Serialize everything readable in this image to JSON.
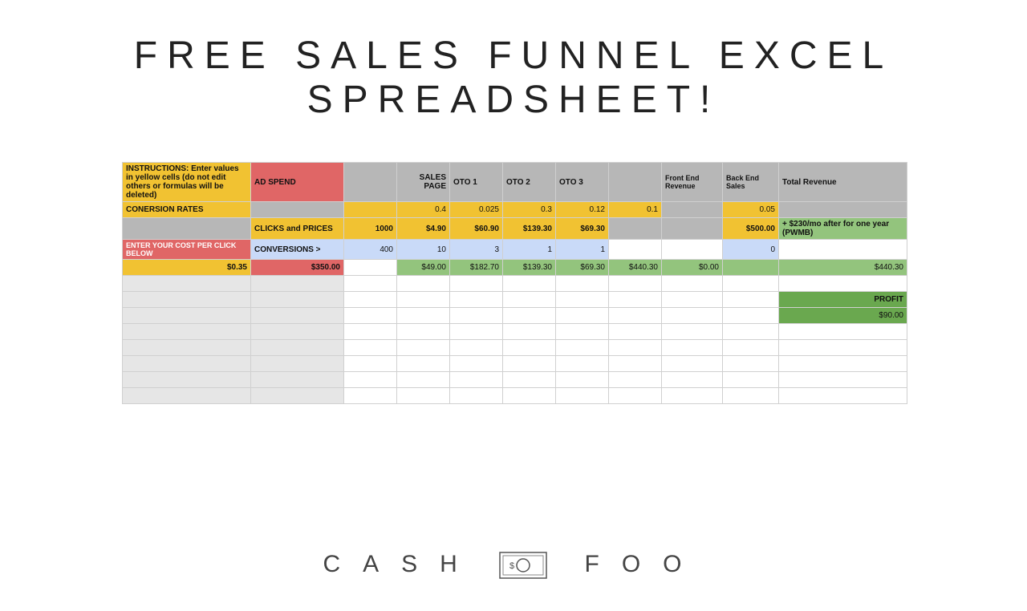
{
  "title": "FREE SALES FUNNEL EXCEL SPREADSHEET!",
  "brand": {
    "left": "CASH",
    "right": "FOO"
  },
  "sheet": {
    "header": {
      "instructions": "INSTRUCTIONS: Enter values in yellow cells (do not edit others or formulas will be deleted)",
      "ad_spend": "AD SPEND",
      "sales_page": "SALES PAGE",
      "oto1": "OTO 1",
      "oto2": "OTO 2",
      "oto3": "OTO 3",
      "front_rev": "Front End Revenue",
      "back_sales": "Back End Sales",
      "total_rev": "Total Revenue"
    },
    "rates": {
      "label": "CONERSION RATES",
      "sales_page": "0.4",
      "oto1": "0.025",
      "oto2": "0.3",
      "oto3": "0.12",
      "front_rev": "0.1",
      "back_sales": "0.05"
    },
    "clicks": {
      "label": "CLICKS and PRICES",
      "val1": "1000",
      "sales_page": "$4.90",
      "oto1": "$60.90",
      "oto2": "$139.30",
      "oto3": "$69.30",
      "back": "$500.00",
      "note": "+ $230/mo after for one year (PWMB)"
    },
    "conv": {
      "left_label": "ENTER YOUR COST PER CLICK BELOW",
      "label": "CONVERSIONS >",
      "val1": "400",
      "sales_page": "10",
      "oto1": "3",
      "oto2": "1",
      "oto3": "1",
      "back": "0"
    },
    "totals": {
      "cpc": "$0.35",
      "spend": "$350.00",
      "sales_page": "$49.00",
      "oto1": "$182.70",
      "oto2": "$139.30",
      "oto3": "$69.30",
      "front": "$440.30",
      "back": "$0.00",
      "total": "$440.30"
    },
    "profit": {
      "label": "PROFIT",
      "value": "$90.00"
    }
  }
}
